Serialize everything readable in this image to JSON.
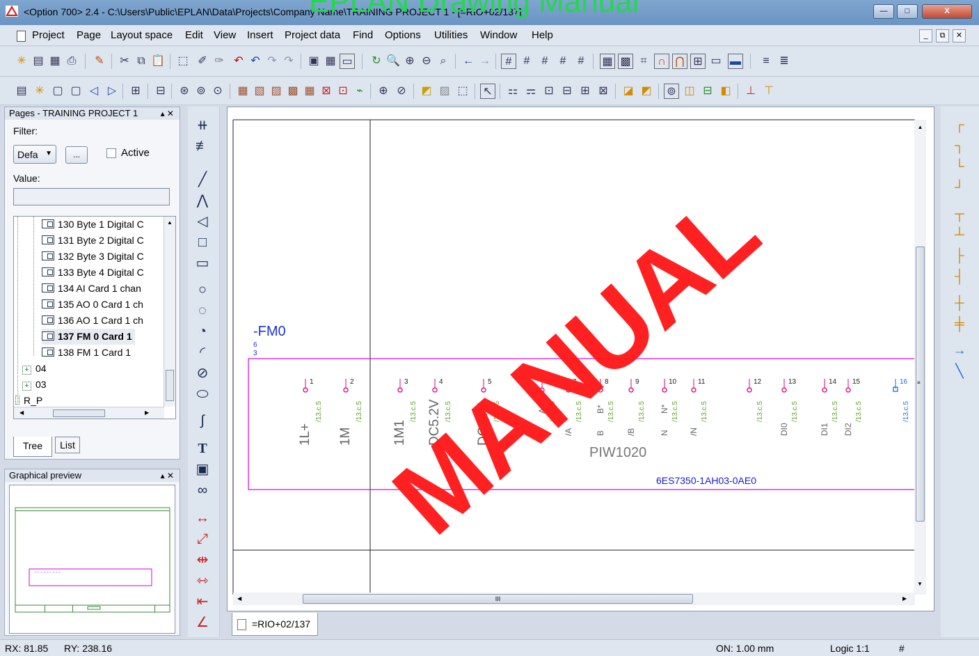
{
  "window": {
    "title": "<Option 700> 2.4 - C:\\Users\\Public\\EPLAN\\Data\\Projects\\Company Name\\TRAINING PROJECT 1 - [=RIO+02/137]",
    "controls": {
      "minimize": "—",
      "maximize": "□",
      "close": "X"
    }
  },
  "menu": {
    "items": [
      "Project",
      "Page",
      "Layout space",
      "Edit",
      "View",
      "Insert",
      "Project data",
      "Find",
      "Options",
      "Utilities",
      "Window",
      "Help"
    ],
    "mdi_controls": [
      "_",
      "⧉",
      "✕"
    ]
  },
  "pages_panel": {
    "title": "Pages - TRAINING PROJECT 1",
    "pin": "▴ ✕",
    "filter_label": "Filter:",
    "filter_value": "Defa",
    "filter_button": "...",
    "active_label": "Active",
    "value_label": "Value:",
    "value_input": "",
    "tree_items": [
      "130 Byte 1 Digital C",
      "131 Byte 2 Digital C",
      "132 Byte 3 Digital C",
      "133 Byte 4 Digital C",
      "134 AI Card 1 chan",
      "135 AO 0 Card 1 ch",
      "136 AO 1 Card 1 ch",
      "137 FM 0 Card 1",
      "138 FM 1 Card 1"
    ],
    "tree_groups": [
      "04",
      "03",
      "R_P"
    ],
    "selected_item": "137 FM 0 Card 1",
    "tabs": [
      "Tree",
      "List"
    ]
  },
  "preview_panel": {
    "title": "Graphical preview",
    "pin": "▴ ✕"
  },
  "schematic": {
    "device_tag": "-FM0",
    "device_ref_top": "6",
    "device_ref_bottom": "3",
    "pins": [
      {
        "num": "1",
        "name": "1L+",
        "ref": "/13.c.5"
      },
      {
        "num": "2",
        "name": "1M",
        "ref": "/13.c.5"
      },
      {
        "num": "3",
        "name": "1M1",
        "ref": "/13.c.5"
      },
      {
        "num": "4",
        "name": "DC5.2V",
        "ref": "/13.c.5"
      },
      {
        "num": "5",
        "name": "DC24V",
        "ref": "/13.c.5"
      },
      {
        "num": "6",
        "name": "A",
        "name2": "A*",
        "ref": "/13.c.5"
      },
      {
        "num": "7",
        "name": "/A",
        "ref": "/13.c.5"
      },
      {
        "num": "8",
        "name": "B",
        "name2": "B*",
        "ref": "/13.c.5"
      },
      {
        "num": "9",
        "name": "/B",
        "ref": "/13.c.5"
      },
      {
        "num": "10",
        "name": "N",
        "name2": "N*",
        "ref": "/13.c.5"
      },
      {
        "num": "11",
        "name": "/N",
        "ref": "/13.c.5"
      },
      {
        "num": "12",
        "name": "",
        "ref": "/13.c.5"
      },
      {
        "num": "13",
        "name": "DI0",
        "ref": "/13.c.5"
      },
      {
        "num": "14",
        "name": "DI1",
        "ref": "/13.c.5"
      },
      {
        "num": "15",
        "name": "DI2",
        "ref": "/13.c.5"
      },
      {
        "num": "16",
        "name": "",
        "ref": "/13.c.5"
      }
    ],
    "address": "PIW1020",
    "part_number": "6ES7350-1AH03-0AE0",
    "scroll_marker": "III"
  },
  "doc_tab": "=RIO+02/137",
  "status": {
    "rx": "RX: 81.85",
    "ry": "RY: 238.16",
    "on": "ON: 1.00 mm",
    "logic": "Logic 1:1",
    "hash": "#"
  },
  "watermarks": {
    "top": "EPLAN Drawing Manual",
    "main": "MANUAL"
  },
  "colors": {
    "magenta": "#d600d6",
    "pin_red": "#e0007a",
    "ref_green": "#5aa02c",
    "tag_blue": "#1a33d6",
    "part_blue": "#1a1ad6",
    "watermark_red": "#ff1a1a"
  }
}
